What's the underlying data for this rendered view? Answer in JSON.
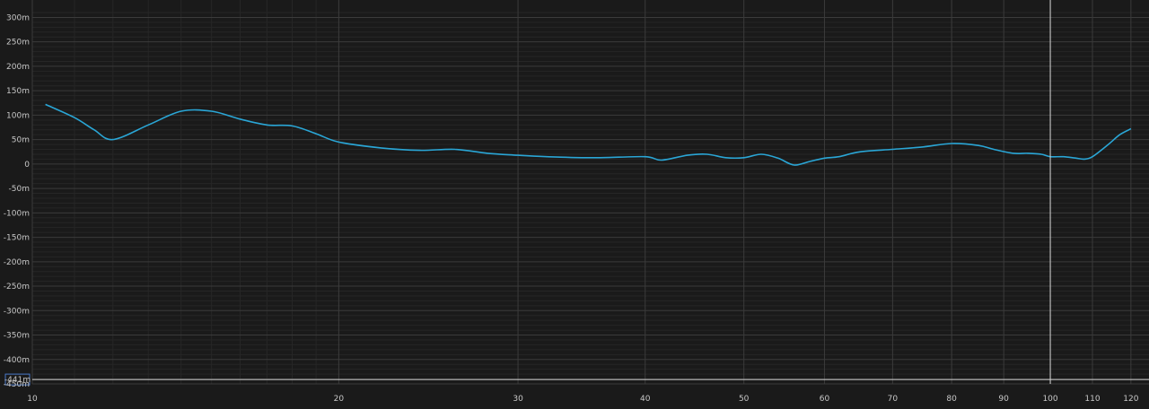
{
  "chart_data": {
    "type": "line",
    "title": "",
    "xlabel": "",
    "ylabel": "",
    "x_scale": "log",
    "xlim": [
      10,
      124
    ],
    "ylim": [
      -450,
      310
    ],
    "x_ticks": [
      {
        "value": 10,
        "label": "10"
      },
      {
        "value": 20,
        "label": "20"
      },
      {
        "value": 30,
        "label": "30"
      },
      {
        "value": 40,
        "label": "40"
      },
      {
        "value": 50,
        "label": "50"
      },
      {
        "value": 60,
        "label": "60"
      },
      {
        "value": 70,
        "label": "70"
      },
      {
        "value": 80,
        "label": "80"
      },
      {
        "value": 90,
        "label": "90"
      },
      {
        "value": 100,
        "label": "100"
      },
      {
        "value": 110,
        "label": "110"
      },
      {
        "value": 120,
        "label": "120"
      }
    ],
    "y_ticks": [
      {
        "value": 300,
        "label": "300m"
      },
      {
        "value": 250,
        "label": "250m"
      },
      {
        "value": 200,
        "label": "200m"
      },
      {
        "value": 150,
        "label": "150m"
      },
      {
        "value": 100,
        "label": "100m"
      },
      {
        "value": 50,
        "label": "50m"
      },
      {
        "value": 0,
        "label": "0"
      },
      {
        "value": -50,
        "label": "-50m"
      },
      {
        "value": -100,
        "label": "-100m"
      },
      {
        "value": -150,
        "label": "-150m"
      },
      {
        "value": -200,
        "label": "-200m"
      },
      {
        "value": -250,
        "label": "-250m"
      },
      {
        "value": -300,
        "label": "-300m"
      },
      {
        "value": -350,
        "label": "-350m"
      },
      {
        "value": -400,
        "label": "-400m"
      },
      {
        "value": -450,
        "label": "-450m"
      }
    ],
    "cursor": {
      "x": 100,
      "y": -441,
      "label": "-441m"
    },
    "grid": true,
    "colors": {
      "background": "#1a1a1a",
      "grid_major": "#3b3b3b",
      "grid_minor": "#262626",
      "series": "#2aa6d6",
      "cursor": "#d8d8d8",
      "cursor_label_border": "#4a78c8",
      "cursor_label_text": "#9cc0f0",
      "tick_text": "#c8c8c8"
    },
    "series": [
      {
        "x": [
          10.3,
          11.0,
          11.5,
          12.0,
          13.0,
          14.0,
          15.0,
          16.0,
          17.0,
          18.0,
          19.0,
          20.0,
          22.0,
          24.0,
          26.0,
          28.0,
          30.0,
          33.0,
          36.0,
          40.0,
          41.5,
          44.0,
          46.0,
          48.0,
          50.0,
          52.0,
          54.0,
          56.0,
          58.0,
          60.0,
          62.0,
          65.0,
          70.0,
          75.0,
          80.0,
          85.0,
          88.0,
          92.0,
          95.0,
          98.0,
          100.0,
          103.0,
          106.0,
          108.0,
          110.0,
          114.0,
          117.0,
          120.0
        ],
        "y": [
          122,
          95,
          70,
          50,
          80,
          108,
          108,
          92,
          80,
          78,
          62,
          45,
          33,
          28,
          30,
          22,
          18,
          14,
          13,
          15,
          8,
          18,
          20,
          13,
          13,
          20,
          12,
          -2,
          5,
          12,
          15,
          25,
          30,
          35,
          42,
          38,
          30,
          22,
          22,
          20,
          15,
          15,
          12,
          10,
          15,
          40,
          60,
          72
        ]
      }
    ]
  }
}
